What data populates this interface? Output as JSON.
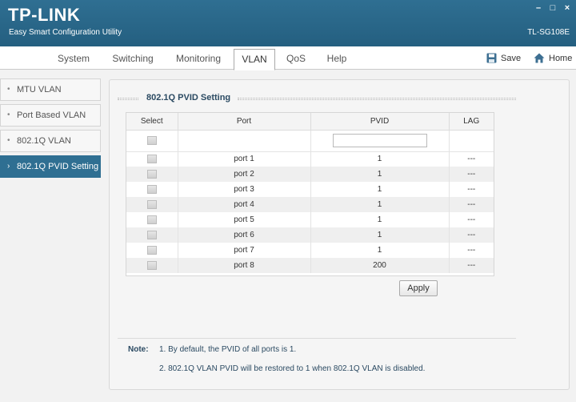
{
  "header": {
    "brand": "TP-LINK",
    "subtitle": "Easy Smart Configuration Utility",
    "model": "TL-SG108E",
    "minimize": "–",
    "maximize": "□",
    "close": "×"
  },
  "nav": {
    "tabs": [
      "System",
      "Switching",
      "Monitoring",
      "VLAN",
      "QoS",
      "Help"
    ],
    "active_tab": "VLAN",
    "save_label": "Save",
    "home_label": "Home"
  },
  "sidebar": {
    "items": [
      "MTU VLAN",
      "Port Based VLAN",
      "802.1Q VLAN",
      "802.1Q PVID Setting"
    ],
    "active_item": "802.1Q PVID Setting"
  },
  "main": {
    "section_title": "802.1Q PVID Setting",
    "columns": {
      "select": "Select",
      "port": "Port",
      "pvid": "PVID",
      "lag": "LAG"
    },
    "pvid_input_value": "",
    "rows": [
      {
        "port": "port 1",
        "pvid": "1",
        "lag": "---"
      },
      {
        "port": "port 2",
        "pvid": "1",
        "lag": "---"
      },
      {
        "port": "port 3",
        "pvid": "1",
        "lag": "---"
      },
      {
        "port": "port 4",
        "pvid": "1",
        "lag": "---"
      },
      {
        "port": "port 5",
        "pvid": "1",
        "lag": "---"
      },
      {
        "port": "port 6",
        "pvid": "1",
        "lag": "---"
      },
      {
        "port": "port 7",
        "pvid": "1",
        "lag": "---"
      },
      {
        "port": "port 8",
        "pvid": "200",
        "lag": "---"
      }
    ],
    "apply_label": "Apply",
    "note_label": "Note:",
    "notes": [
      "1. By default, the PVID of all ports is 1.",
      "2. 802.1Q VLAN PVID will be restored to 1 when 802.1Q VLAN is disabled."
    ]
  },
  "colors": {
    "header_bg": "#2f6f92",
    "active_sidebar_bg": "#2f6f92",
    "title_text": "#2b4a62"
  },
  "icons": {
    "save": "floppy-disk-icon",
    "home": "house-icon"
  }
}
